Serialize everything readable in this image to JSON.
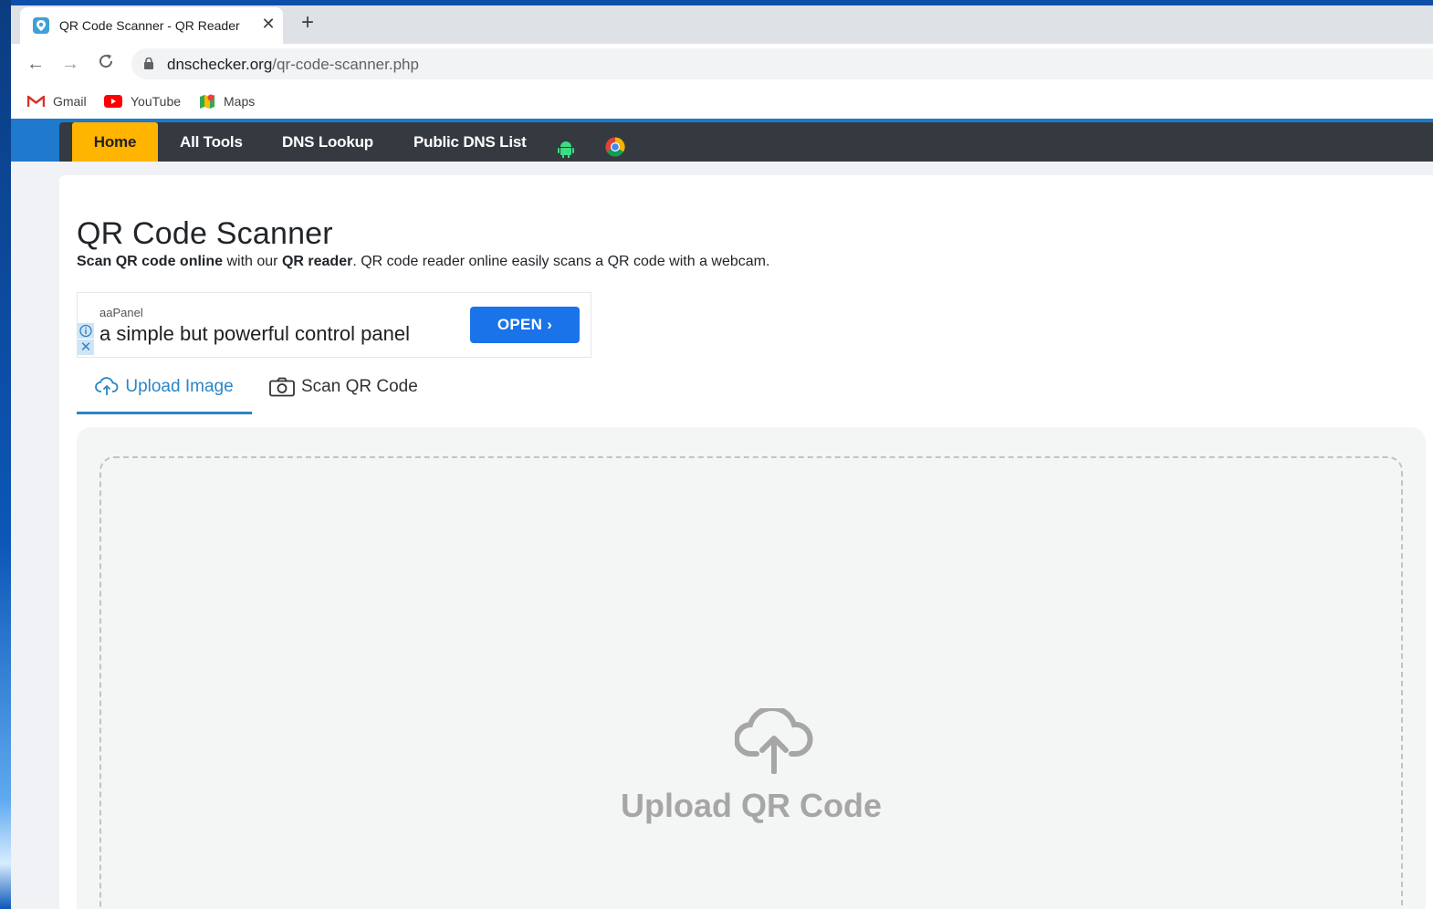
{
  "browser": {
    "tab_title": "QR Code Scanner - QR Reader",
    "tab_close": "✕",
    "new_tab": "+",
    "url_host": "dnschecker.org",
    "url_path": "/qr-code-scanner.php",
    "nav": {
      "back": "←",
      "forward": "→",
      "reload": "C"
    }
  },
  "bookmarks": [
    {
      "label": "Gmail",
      "icon": "gmail-icon"
    },
    {
      "label": "YouTube",
      "icon": "youtube-icon"
    },
    {
      "label": "Maps",
      "icon": "maps-icon"
    }
  ],
  "site_nav": {
    "items": [
      "Home",
      "All Tools",
      "DNS Lookup",
      "Public DNS List"
    ],
    "icons": [
      "android-icon",
      "chrome-icon"
    ],
    "active": "Home"
  },
  "page": {
    "title": "QR Code Scanner",
    "intro_bold1": "Scan QR code online",
    "intro_text1": " with our ",
    "intro_bold2": "QR reader",
    "intro_text2": ". QR code reader online easily scans a QR code with a webcam."
  },
  "ad": {
    "brand": "aaPanel",
    "text": "a simple but powerful control panel",
    "button": "OPEN",
    "close": "✕"
  },
  "tabs": {
    "upload": "Upload Image",
    "scan": "Scan QR Code",
    "active": "Upload Image"
  },
  "dropzone": {
    "label": "Upload QR Code"
  },
  "colors": {
    "nav_bg": "#343a40",
    "home_bg": "#ffb400",
    "accent": "#2a86c5",
    "ad_button": "#1a73e8"
  }
}
